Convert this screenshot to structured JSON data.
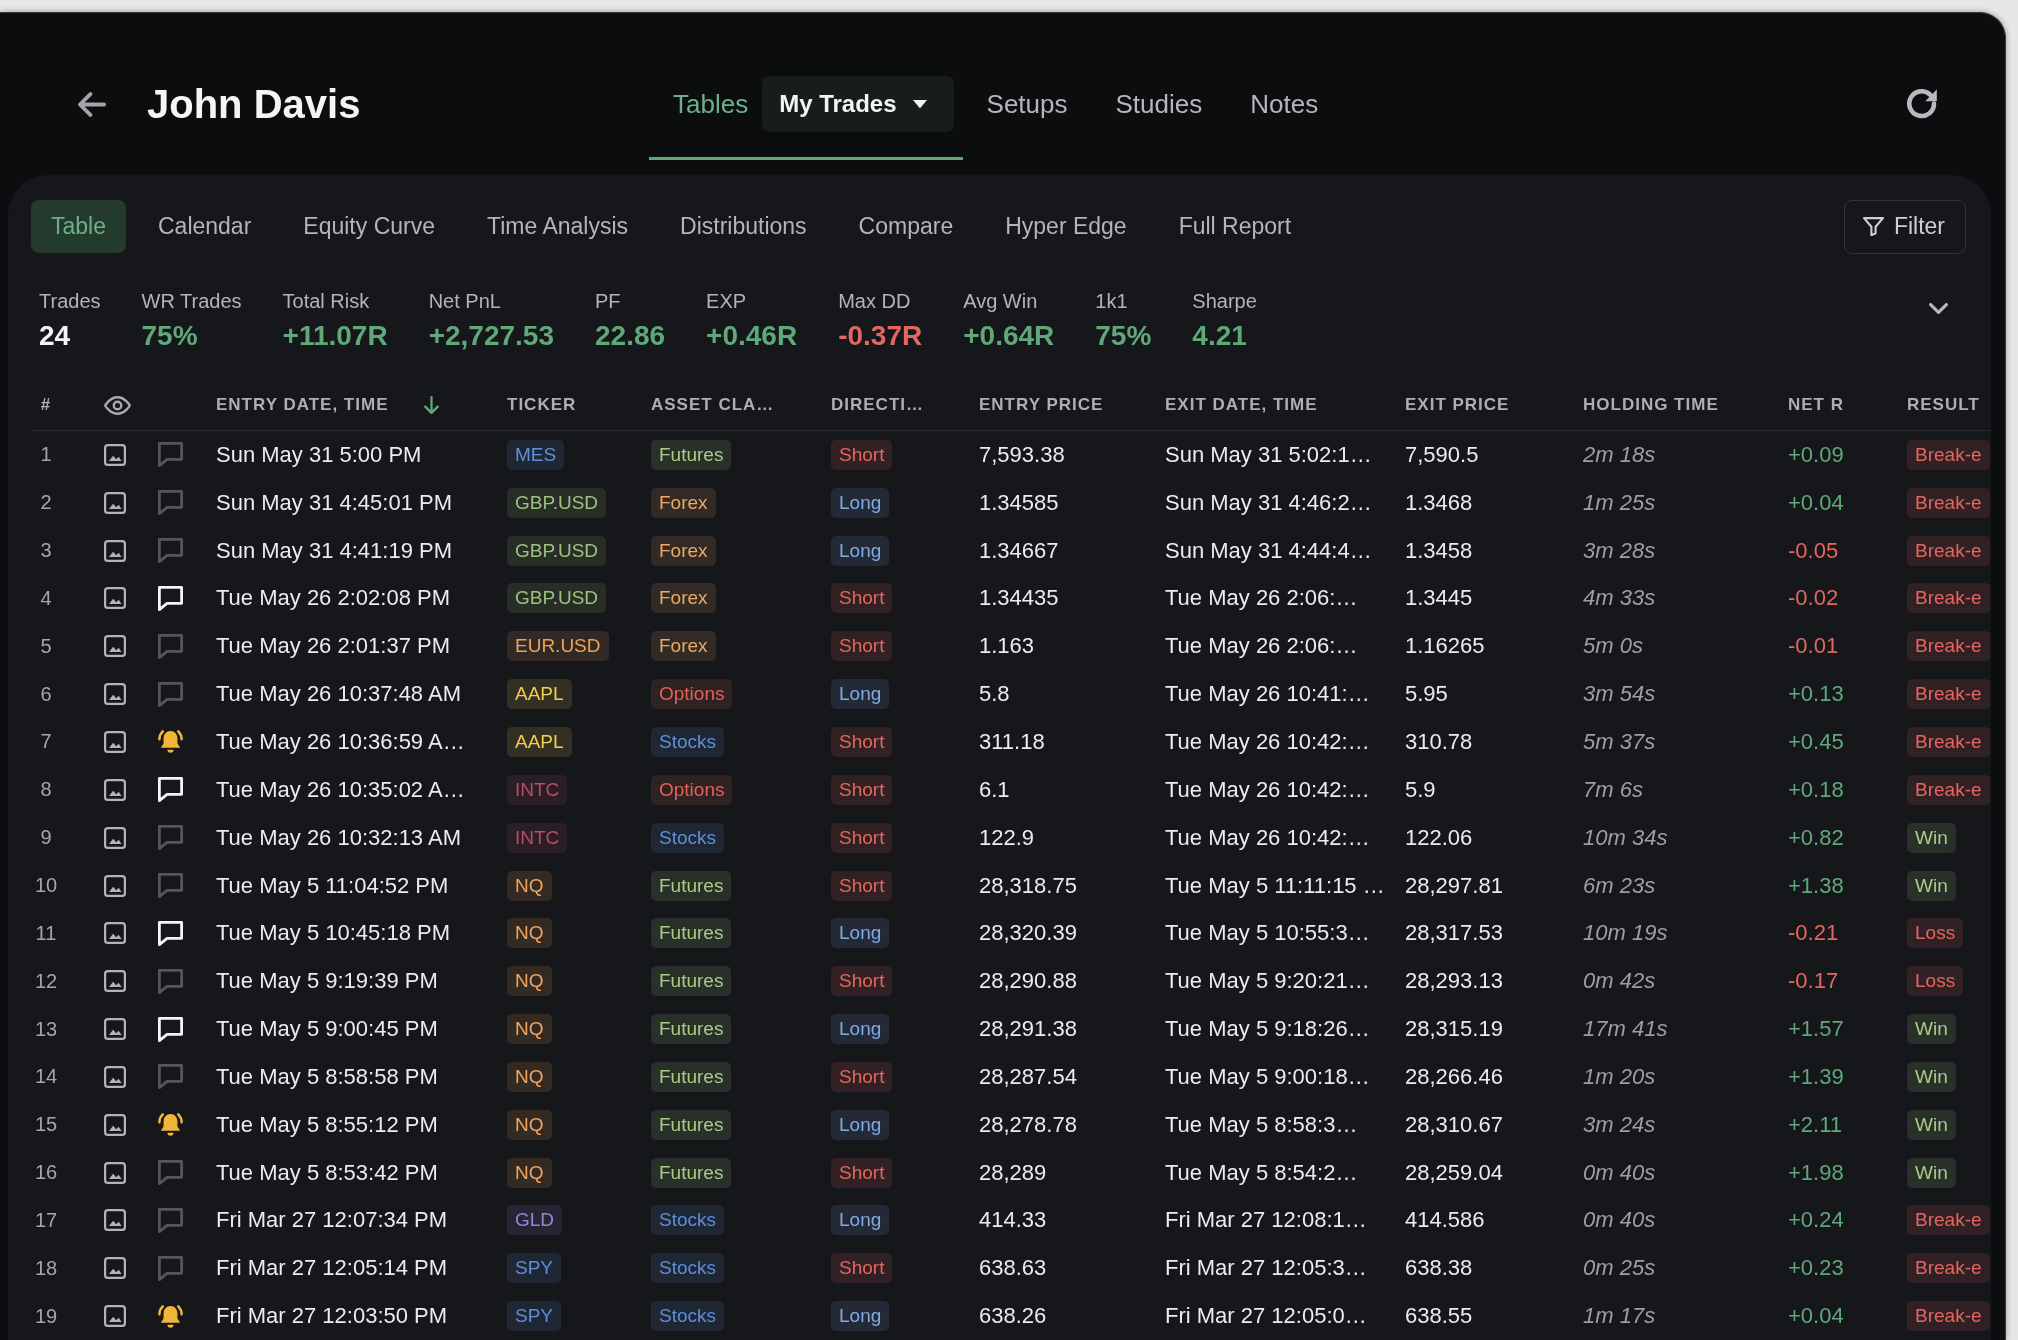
{
  "header": {
    "title": "John Davis"
  },
  "nav": {
    "items": [
      {
        "label": "Tables",
        "selected": true,
        "dropdown": {
          "label": "My Trades"
        }
      },
      {
        "label": "Setups",
        "selected": false
      },
      {
        "label": "Studies",
        "selected": false
      },
      {
        "label": "Notes",
        "selected": false
      }
    ]
  },
  "view_tabs": [
    {
      "label": "Table",
      "selected": true
    },
    {
      "label": "Calendar",
      "selected": false
    },
    {
      "label": "Equity Curve",
      "selected": false
    },
    {
      "label": "Time Analysis",
      "selected": false
    },
    {
      "label": "Distributions",
      "selected": false
    },
    {
      "label": "Compare",
      "selected": false
    },
    {
      "label": "Hyper Edge",
      "selected": false
    },
    {
      "label": "Full Report",
      "selected": false
    }
  ],
  "filter_button": {
    "label": "Filter"
  },
  "stats": [
    {
      "label": "Trades",
      "value": "24",
      "color": "#f4f4f6"
    },
    {
      "label": "WR Trades",
      "value": "75%",
      "color": "#5fa87a"
    },
    {
      "label": "Total Risk",
      "value": "+11.07R",
      "color": "#5fa87a"
    },
    {
      "label": "Net PnL",
      "value": "+2,727.53",
      "color": "#5fa87a"
    },
    {
      "label": "PF",
      "value": "22.86",
      "color": "#5fa87a"
    },
    {
      "label": "EXP",
      "value": "+0.46R",
      "color": "#5fa87a"
    },
    {
      "label": "Max DD",
      "value": "-0.37R",
      "color": "#e4665e"
    },
    {
      "label": "Avg Win",
      "value": "+0.64R",
      "color": "#5fa87a"
    },
    {
      "label": "1k1",
      "value": "75%",
      "color": "#5fa87a"
    },
    {
      "label": "Sharpe",
      "value": "4.21",
      "color": "#5fa87a"
    }
  ],
  "table": {
    "columns": [
      {
        "label": "#",
        "sorted": false
      },
      {
        "label": "ENTRY DATE, TIME",
        "sorted": true
      },
      {
        "label": "TICKER",
        "sorted": false
      },
      {
        "label": "ASSET CLA…",
        "sorted": false
      },
      {
        "label": "DIRECTI…",
        "sorted": false
      },
      {
        "label": "ENTRY PRICE",
        "sorted": false
      },
      {
        "label": "EXIT DATE, TIME",
        "sorted": false
      },
      {
        "label": "EXIT PRICE",
        "sorted": false
      },
      {
        "label": "HOLDING TIME",
        "sorted": false
      },
      {
        "label": "NET R",
        "sorted": false
      },
      {
        "label": "RESULT",
        "sorted": false
      }
    ],
    "rows": [
      {
        "number": "1",
        "note": {
          "kind": "empty"
        },
        "entry_time": "Sun May 31 5:00 PM",
        "ticker": {
          "text": "MES",
          "color": "#5f8fd8"
        },
        "asset_class": {
          "text": "Futures",
          "color": "#a8cd84"
        },
        "direction": {
          "text": "Short",
          "color": "#e4665e"
        },
        "entry_price": "7,593.38",
        "exit_time": "Sun May 31 5:02:1…",
        "exit_price": "7,590.5",
        "holding_time": "2m 18s",
        "net_r": {
          "text": "+0.09",
          "color": "#5fa87a"
        },
        "result": {
          "text": "Break-e",
          "color": "#e4665e"
        }
      },
      {
        "number": "2",
        "note": {
          "kind": "empty"
        },
        "entry_time": "Sun May 31 4:45:01 PM",
        "ticker": {
          "text": "GBP.USD",
          "color": "#9dc27c"
        },
        "asset_class": {
          "text": "Forex",
          "color": "#efa965"
        },
        "direction": {
          "text": "Long",
          "color": "#7eaae6"
        },
        "entry_price": "1.34585",
        "exit_time": "Sun May 31 4:46:2…",
        "exit_price": "1.3468",
        "holding_time": "1m 25s",
        "net_r": {
          "text": "+0.04",
          "color": "#5fa87a"
        },
        "result": {
          "text": "Break-e",
          "color": "#e4665e"
        }
      },
      {
        "number": "3",
        "note": {
          "kind": "empty"
        },
        "entry_time": "Sun May 31 4:41:19 PM",
        "ticker": {
          "text": "GBP.USD",
          "color": "#9dc27c"
        },
        "asset_class": {
          "text": "Forex",
          "color": "#efa965"
        },
        "direction": {
          "text": "Long",
          "color": "#7eaae6"
        },
        "entry_price": "1.34667",
        "exit_time": "Sun May 31 4:44:4…",
        "exit_price": "1.3458",
        "holding_time": "3m 28s",
        "net_r": {
          "text": "-0.05",
          "color": "#e4665e"
        },
        "result": {
          "text": "Break-e",
          "color": "#e4665e"
        }
      },
      {
        "number": "4",
        "note": {
          "kind": "present"
        },
        "entry_time": "Tue May 26 2:02:08 PM",
        "ticker": {
          "text": "GBP.USD",
          "color": "#9dc27c"
        },
        "asset_class": {
          "text": "Forex",
          "color": "#efa965"
        },
        "direction": {
          "text": "Short",
          "color": "#e4665e"
        },
        "entry_price": "1.34435",
        "exit_time": "Tue May 26 2:06:…",
        "exit_price": "1.3445",
        "holding_time": "4m 33s",
        "net_r": {
          "text": "-0.02",
          "color": "#e4665e"
        },
        "result": {
          "text": "Break-e",
          "color": "#e4665e"
        }
      },
      {
        "number": "5",
        "note": {
          "kind": "empty"
        },
        "entry_time": "Tue May 26 2:01:37 PM",
        "ticker": {
          "text": "EUR.USD",
          "color": "#eaa35d"
        },
        "asset_class": {
          "text": "Forex",
          "color": "#efa965"
        },
        "direction": {
          "text": "Short",
          "color": "#e4665e"
        },
        "entry_price": "1.163",
        "exit_time": "Tue May 26 2:06:…",
        "exit_price": "1.16265",
        "holding_time": "5m 0s",
        "net_r": {
          "text": "-0.01",
          "color": "#e4665e"
        },
        "result": {
          "text": "Break-e",
          "color": "#e4665e"
        }
      },
      {
        "number": "6",
        "note": {
          "kind": "empty"
        },
        "entry_time": "Tue May 26 10:37:48 AM",
        "ticker": {
          "text": "AAPL",
          "color": "#f2cd52"
        },
        "asset_class": {
          "text": "Options",
          "color": "#df625a"
        },
        "direction": {
          "text": "Long",
          "color": "#7eaae6"
        },
        "entry_price": "5.8",
        "exit_time": "Tue May 26 10:41:…",
        "exit_price": "5.95",
        "holding_time": "3m 54s",
        "net_r": {
          "text": "+0.13",
          "color": "#5fa87a"
        },
        "result": {
          "text": "Break-e",
          "color": "#e4665e"
        }
      },
      {
        "number": "7",
        "note": {
          "kind": "alert"
        },
        "entry_time": "Tue May 26 10:36:59 A…",
        "ticker": {
          "text": "AAPL",
          "color": "#f2cd52"
        },
        "asset_class": {
          "text": "Stocks",
          "color": "#5f8fd8"
        },
        "direction": {
          "text": "Short",
          "color": "#e4665e"
        },
        "entry_price": "311.18",
        "exit_time": "Tue May 26 10:42:…",
        "exit_price": "310.78",
        "holding_time": "5m 37s",
        "net_r": {
          "text": "+0.45",
          "color": "#5fa87a"
        },
        "result": {
          "text": "Break-e",
          "color": "#e4665e"
        }
      },
      {
        "number": "8",
        "note": {
          "kind": "present"
        },
        "entry_time": "Tue May 26 10:35:02 A…",
        "ticker": {
          "text": "INTC",
          "color": "#b54e6b"
        },
        "asset_class": {
          "text": "Options",
          "color": "#df625a"
        },
        "direction": {
          "text": "Short",
          "color": "#e4665e"
        },
        "entry_price": "6.1",
        "exit_time": "Tue May 26 10:42:…",
        "exit_price": "5.9",
        "holding_time": "7m 6s",
        "net_r": {
          "text": "+0.18",
          "color": "#5fa87a"
        },
        "result": {
          "text": "Break-e",
          "color": "#e4665e"
        }
      },
      {
        "number": "9",
        "note": {
          "kind": "empty"
        },
        "entry_time": "Tue May 26 10:32:13 AM",
        "ticker": {
          "text": "INTC",
          "color": "#b54e6b"
        },
        "asset_class": {
          "text": "Stocks",
          "color": "#5f8fd8"
        },
        "direction": {
          "text": "Short",
          "color": "#e4665e"
        },
        "entry_price": "122.9",
        "exit_time": "Tue May 26 10:42:…",
        "exit_price": "122.06",
        "holding_time": "10m 34s",
        "net_r": {
          "text": "+0.82",
          "color": "#5fa87a"
        },
        "result": {
          "text": "Win",
          "color": "#a8cd84"
        }
      },
      {
        "number": "10",
        "note": {
          "kind": "empty"
        },
        "entry_time": "Tue May 5 11:04:52 PM",
        "ticker": {
          "text": "NQ",
          "color": "#f0a65b"
        },
        "asset_class": {
          "text": "Futures",
          "color": "#a8cd84"
        },
        "direction": {
          "text": "Short",
          "color": "#e4665e"
        },
        "entry_price": "28,318.75",
        "exit_time": "Tue May 5 11:11:15 …",
        "exit_price": "28,297.81",
        "holding_time": "6m 23s",
        "net_r": {
          "text": "+1.38",
          "color": "#5fa87a"
        },
        "result": {
          "text": "Win",
          "color": "#a8cd84"
        }
      },
      {
        "number": "11",
        "note": {
          "kind": "present"
        },
        "entry_time": "Tue May 5 10:45:18 PM",
        "ticker": {
          "text": "NQ",
          "color": "#f0a65b"
        },
        "asset_class": {
          "text": "Futures",
          "color": "#a8cd84"
        },
        "direction": {
          "text": "Long",
          "color": "#7eaae6"
        },
        "entry_price": "28,320.39",
        "exit_time": "Tue May 5 10:55:3…",
        "exit_price": "28,317.53",
        "holding_time": "10m 19s",
        "net_r": {
          "text": "-0.21",
          "color": "#e4665e"
        },
        "result": {
          "text": "Loss",
          "color": "#e4665e"
        }
      },
      {
        "number": "12",
        "note": {
          "kind": "empty"
        },
        "entry_time": "Tue May 5 9:19:39 PM",
        "ticker": {
          "text": "NQ",
          "color": "#f0a65b"
        },
        "asset_class": {
          "text": "Futures",
          "color": "#a8cd84"
        },
        "direction": {
          "text": "Short",
          "color": "#e4665e"
        },
        "entry_price": "28,290.88",
        "exit_time": "Tue May 5 9:20:21…",
        "exit_price": "28,293.13",
        "holding_time": "0m 42s",
        "net_r": {
          "text": "-0.17",
          "color": "#e4665e"
        },
        "result": {
          "text": "Loss",
          "color": "#e4665e"
        }
      },
      {
        "number": "13",
        "note": {
          "kind": "present"
        },
        "entry_time": "Tue May 5 9:00:45 PM",
        "ticker": {
          "text": "NQ",
          "color": "#f0a65b"
        },
        "asset_class": {
          "text": "Futures",
          "color": "#a8cd84"
        },
        "direction": {
          "text": "Long",
          "color": "#7eaae6"
        },
        "entry_price": "28,291.38",
        "exit_time": "Tue May 5 9:18:26…",
        "exit_price": "28,315.19",
        "holding_time": "17m 41s",
        "net_r": {
          "text": "+1.57",
          "color": "#5fa87a"
        },
        "result": {
          "text": "Win",
          "color": "#a8cd84"
        }
      },
      {
        "number": "14",
        "note": {
          "kind": "empty"
        },
        "entry_time": "Tue May 5 8:58:58 PM",
        "ticker": {
          "text": "NQ",
          "color": "#f0a65b"
        },
        "asset_class": {
          "text": "Futures",
          "color": "#a8cd84"
        },
        "direction": {
          "text": "Short",
          "color": "#e4665e"
        },
        "entry_price": "28,287.54",
        "exit_time": "Tue May 5 9:00:18…",
        "exit_price": "28,266.46",
        "holding_time": "1m 20s",
        "net_r": {
          "text": "+1.39",
          "color": "#5fa87a"
        },
        "result": {
          "text": "Win",
          "color": "#a8cd84"
        }
      },
      {
        "number": "15",
        "note": {
          "kind": "alert"
        },
        "entry_time": "Tue May 5 8:55:12 PM",
        "ticker": {
          "text": "NQ",
          "color": "#f0a65b"
        },
        "asset_class": {
          "text": "Futures",
          "color": "#a8cd84"
        },
        "direction": {
          "text": "Long",
          "color": "#7eaae6"
        },
        "entry_price": "28,278.78",
        "exit_time": "Tue May 5 8:58:3…",
        "exit_price": "28,310.67",
        "holding_time": "3m 24s",
        "net_r": {
          "text": "+2.11",
          "color": "#5fa87a"
        },
        "result": {
          "text": "Win",
          "color": "#a8cd84"
        }
      },
      {
        "number": "16",
        "note": {
          "kind": "empty"
        },
        "entry_time": "Tue May 5 8:53:42 PM",
        "ticker": {
          "text": "NQ",
          "color": "#f0a65b"
        },
        "asset_class": {
          "text": "Futures",
          "color": "#a8cd84"
        },
        "direction": {
          "text": "Short",
          "color": "#e4665e"
        },
        "entry_price": "28,289",
        "exit_time": "Tue May 5 8:54:2…",
        "exit_price": "28,259.04",
        "holding_time": "0m 40s",
        "net_r": {
          "text": "+1.98",
          "color": "#5fa87a"
        },
        "result": {
          "text": "Win",
          "color": "#a8cd84"
        }
      },
      {
        "number": "17",
        "note": {
          "kind": "empty"
        },
        "entry_time": "Fri Mar 27 12:07:34 PM",
        "ticker": {
          "text": "GLD",
          "color": "#9a83d3"
        },
        "asset_class": {
          "text": "Stocks",
          "color": "#5f8fd8"
        },
        "direction": {
          "text": "Long",
          "color": "#7eaae6"
        },
        "entry_price": "414.33",
        "exit_time": "Fri Mar 27 12:08:1…",
        "exit_price": "414.586",
        "holding_time": "0m 40s",
        "net_r": {
          "text": "+0.24",
          "color": "#5fa87a"
        },
        "result": {
          "text": "Break-e",
          "color": "#e4665e"
        }
      },
      {
        "number": "18",
        "note": {
          "kind": "empty"
        },
        "entry_time": "Fri Mar 27 12:05:14 PM",
        "ticker": {
          "text": "SPY",
          "color": "#5f8fd8"
        },
        "asset_class": {
          "text": "Stocks",
          "color": "#5f8fd8"
        },
        "direction": {
          "text": "Short",
          "color": "#e4665e"
        },
        "entry_price": "638.63",
        "exit_time": "Fri Mar 27 12:05:3…",
        "exit_price": "638.38",
        "holding_time": "0m 25s",
        "net_r": {
          "text": "+0.23",
          "color": "#5fa87a"
        },
        "result": {
          "text": "Break-e",
          "color": "#e4665e"
        }
      },
      {
        "number": "19",
        "note": {
          "kind": "alert"
        },
        "entry_time": "Fri Mar 27 12:03:50 PM",
        "ticker": {
          "text": "SPY",
          "color": "#5f8fd8"
        },
        "asset_class": {
          "text": "Stocks",
          "color": "#5f8fd8"
        },
        "direction": {
          "text": "Long",
          "color": "#7eaae6"
        },
        "entry_price": "638.26",
        "exit_time": "Fri Mar 27 12:05:0…",
        "exit_price": "638.55",
        "holding_time": "1m 17s",
        "net_r": {
          "text": "+0.04",
          "color": "#5fa87a"
        },
        "result": {
          "text": "Break-e",
          "color": "#e4665e"
        }
      }
    ]
  }
}
